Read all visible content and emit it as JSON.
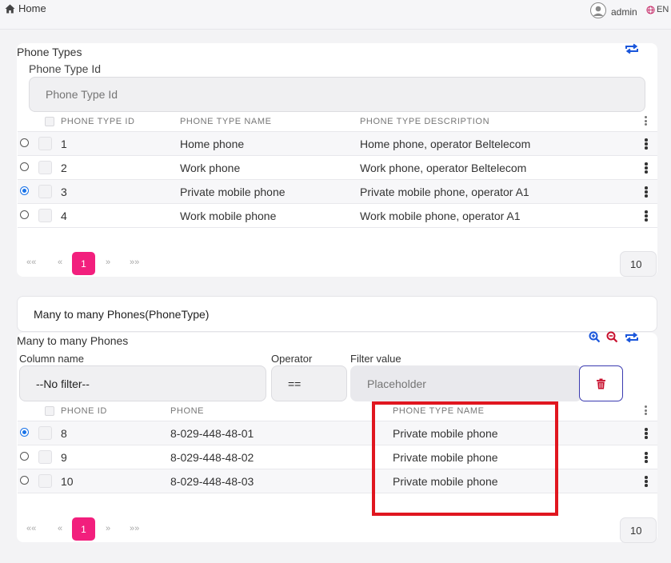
{
  "header": {
    "home_label": "Home",
    "user_name": "admin",
    "language": "EN"
  },
  "phone_types": {
    "title": "Phone Types",
    "filter_label": "Phone Type Id",
    "filter_placeholder": "Phone Type Id",
    "columns": [
      "PHONE TYPE ID",
      "PHONE TYPE NAME",
      "PHONE TYPE DESCRIPTION"
    ],
    "rows": [
      {
        "id": "1",
        "name": "Home phone",
        "description": "Home phone, operator Beltelecom",
        "selected": false
      },
      {
        "id": "2",
        "name": "Work phone",
        "description": "Work phone, operator Beltelecom",
        "selected": false
      },
      {
        "id": "3",
        "name": "Private mobile phone",
        "description": "Private mobile phone, operator A1",
        "selected": true
      },
      {
        "id": "4",
        "name": "Work mobile phone",
        "description": "Work mobile phone, operator A1",
        "selected": false
      }
    ],
    "pagination": {
      "first": "««",
      "prev": "«",
      "current": "1",
      "next": "»",
      "last": "»»",
      "page_size": "10"
    }
  },
  "relation_header": "Many to many Phones(PhoneType)",
  "phones": {
    "title": "Many to many Phones",
    "filter": {
      "column_label": "Column name",
      "column_value": "--No filter--",
      "operator_label": "Operator",
      "operator_value": "==",
      "value_label": "Filter value",
      "value_placeholder": "Placeholder"
    },
    "columns": [
      "PHONE ID",
      "PHONE",
      "PHONE TYPE NAME"
    ],
    "rows": [
      {
        "id": "8",
        "phone": "8-029-448-48-01",
        "type_name": "Private mobile phone",
        "selected": true
      },
      {
        "id": "9",
        "phone": "8-029-448-48-02",
        "type_name": "Private mobile phone",
        "selected": false
      },
      {
        "id": "10",
        "phone": "8-029-448-48-03",
        "type_name": "Private mobile phone",
        "selected": false
      }
    ],
    "pagination": {
      "first": "««",
      "prev": "«",
      "current": "1",
      "next": "»",
      "last": "»»",
      "page_size": "10"
    }
  },
  "colors": {
    "accent_pink": "#f21f7d",
    "icon_blue": "#1a56db",
    "delete_red": "#c8102e",
    "highlight_box": "#e0161f"
  }
}
